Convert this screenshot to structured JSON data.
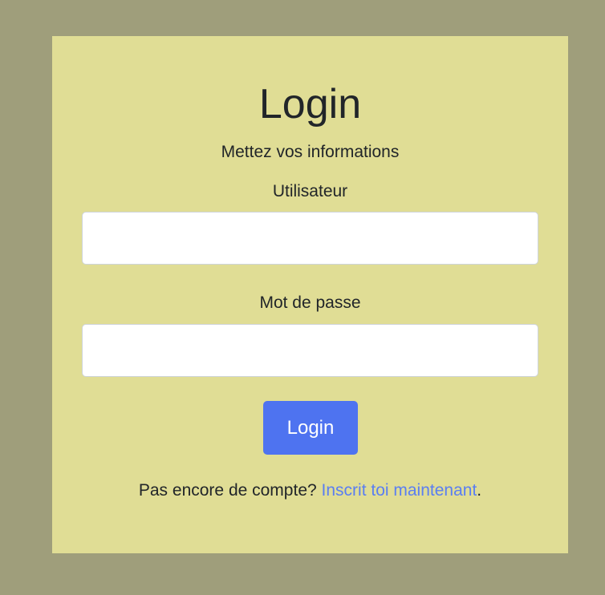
{
  "colors": {
    "page_background": "#9f9e7b",
    "card_background": "#e0dd95",
    "button": "#4e73f0",
    "link": "#5a7ef2"
  },
  "login_card": {
    "title": "Login",
    "subtitle": "Mettez vos informations",
    "username_label": "Utilisateur",
    "username_value": "",
    "password_label": "Mot de passe",
    "password_value": "",
    "submit_label": "Login",
    "footer_text": "Pas encore de compte? ",
    "footer_link": "Inscrit toi maintenant",
    "footer_end": "."
  }
}
